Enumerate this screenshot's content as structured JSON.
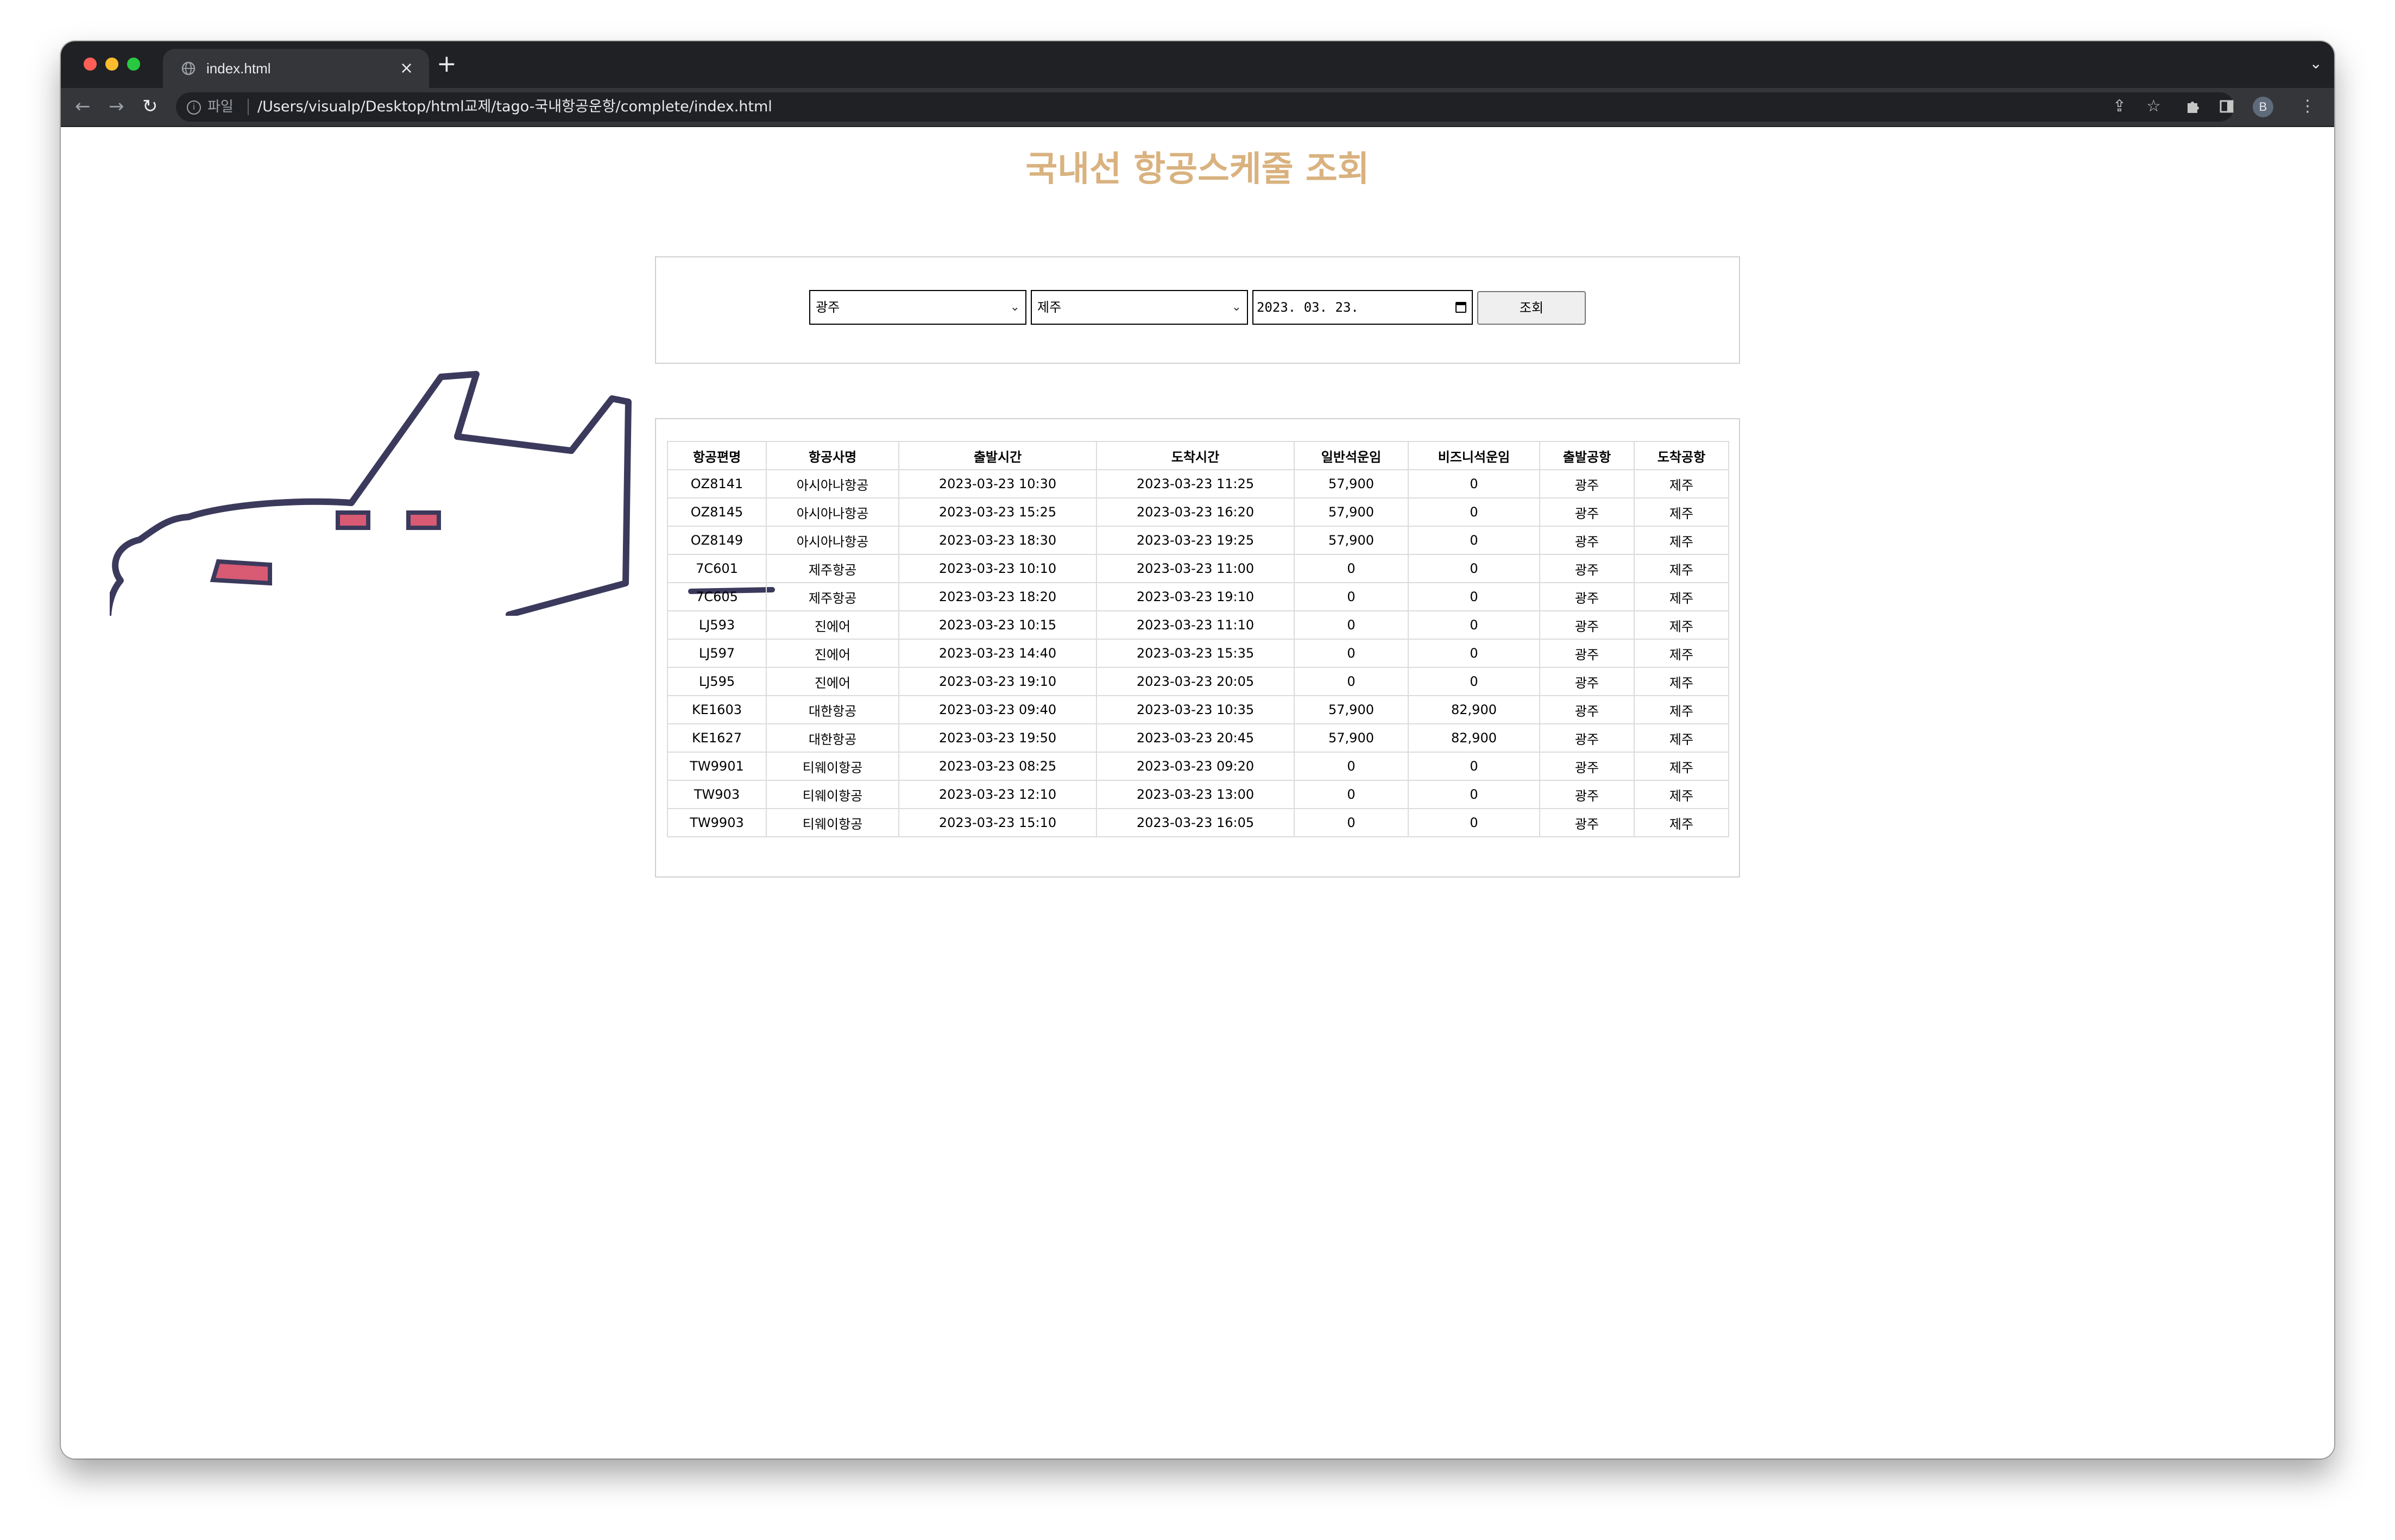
{
  "browser": {
    "tab_title": "index.html",
    "tab_close": "×",
    "new_tab": "+",
    "tab_menu": "⌄",
    "nav_back": "←",
    "nav_forward": "→",
    "reload": "↻",
    "url_scheme_label": "파일",
    "url": "/Users/visualp/Desktop/html교제/tago-국내항공운항/complete/index.html",
    "profile_initial": "B",
    "icons": [
      "globe-icon",
      "info-icon",
      "share-icon",
      "star-icon",
      "puzzle-icon",
      "side-panel-icon",
      "kebab-menu-icon"
    ]
  },
  "page": {
    "title": "국내선 항공스케줄 조회",
    "title_color": "#d9b27f"
  },
  "search": {
    "departure": "광주",
    "arrival": "제주",
    "date": "2023. 03. 23.",
    "button_label": "조회"
  },
  "table": {
    "headers": [
      "항공편명",
      "항공사명",
      "출발시간",
      "도착시간",
      "일반석운임",
      "비즈니석운임",
      "출발공항",
      "도착공항"
    ],
    "rows": [
      [
        "OZ8141",
        "아시아나항공",
        "2023-03-23 10:30",
        "2023-03-23 11:25",
        "57,900",
        "0",
        "광주",
        "제주"
      ],
      [
        "OZ8145",
        "아시아나항공",
        "2023-03-23 15:25",
        "2023-03-23 16:20",
        "57,900",
        "0",
        "광주",
        "제주"
      ],
      [
        "OZ8149",
        "아시아나항공",
        "2023-03-23 18:30",
        "2023-03-23 19:25",
        "57,900",
        "0",
        "광주",
        "제주"
      ],
      [
        "7C601",
        "제주항공",
        "2023-03-23 10:10",
        "2023-03-23 11:00",
        "0",
        "0",
        "광주",
        "제주"
      ],
      [
        "7C605",
        "제주항공",
        "2023-03-23 18:20",
        "2023-03-23 19:10",
        "0",
        "0",
        "광주",
        "제주"
      ],
      [
        "LJ593",
        "진에어",
        "2023-03-23 10:15",
        "2023-03-23 11:10",
        "0",
        "0",
        "광주",
        "제주"
      ],
      [
        "LJ597",
        "진에어",
        "2023-03-23 14:40",
        "2023-03-23 15:35",
        "0",
        "0",
        "광주",
        "제주"
      ],
      [
        "LJ595",
        "진에어",
        "2023-03-23 19:10",
        "2023-03-23 20:05",
        "0",
        "0",
        "광주",
        "제주"
      ],
      [
        "KE1603",
        "대한항공",
        "2023-03-23 09:40",
        "2023-03-23 10:35",
        "57,900",
        "82,900",
        "광주",
        "제주"
      ],
      [
        "KE1627",
        "대한항공",
        "2023-03-23 19:50",
        "2023-03-23 20:45",
        "57,900",
        "82,900",
        "광주",
        "제주"
      ],
      [
        "TW9901",
        "티웨이항공",
        "2023-03-23 08:25",
        "2023-03-23 09:20",
        "0",
        "0",
        "광주",
        "제주"
      ],
      [
        "TW903",
        "티웨이항공",
        "2023-03-23 12:10",
        "2023-03-23 13:00",
        "0",
        "0",
        "광주",
        "제주"
      ],
      [
        "TW9903",
        "티웨이항공",
        "2023-03-23 15:10",
        "2023-03-23 16:05",
        "0",
        "0",
        "광주",
        "제주"
      ]
    ]
  },
  "illustration": {
    "name": "airplane-illustration",
    "outline_color": "#3b3a5c",
    "window_color": "#d95a73"
  }
}
